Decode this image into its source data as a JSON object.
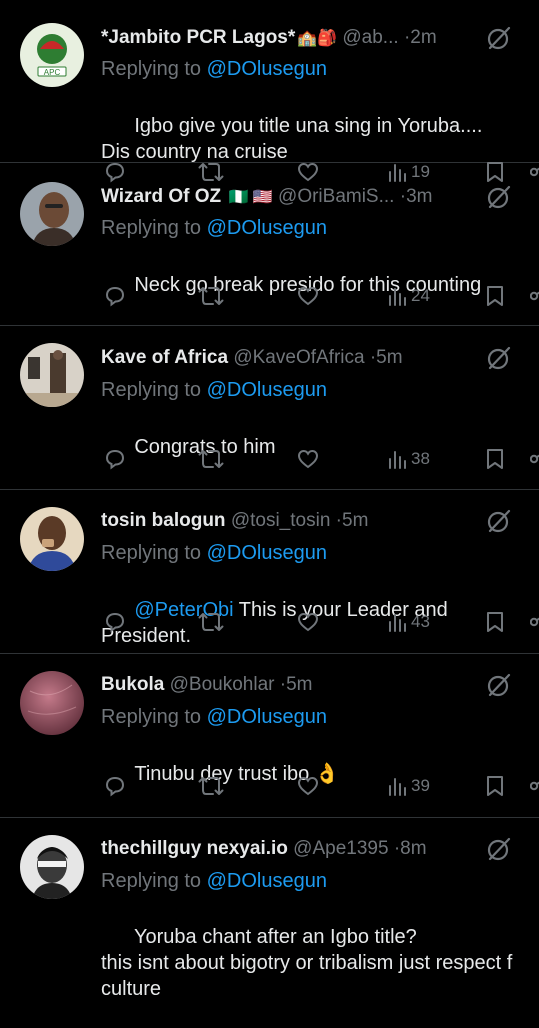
{
  "replying_label": "Replying to",
  "tweets": [
    {
      "name": "*Jambito PCR Lagos*",
      "flags": "🏫🎒",
      "handle": "@ab...",
      "dot": "·",
      "time": "2m",
      "replying_to": "@DOlusegun",
      "mention_prefix": "",
      "text": "Igbo give you title una sing in Yoruba.... Dis country na cruise",
      "views": "19",
      "avatar_label": "APC",
      "avatar_color": "#e8f0e0"
    },
    {
      "name": "Wizard Of OZ",
      "flags": "🇳🇬 🇺🇸",
      "handle": "@OriBamiS...",
      "dot": "·",
      "time": "3m",
      "replying_to": "@DOlusegun",
      "mention_prefix": "",
      "text": "Neck go break presido for this counting",
      "views": "24",
      "avatar_color": "#7a5a45"
    },
    {
      "name": "Kave of Africa",
      "flags": "",
      "handle": "@KaveOfAfrica",
      "dot": "·",
      "time": "5m",
      "replying_to": "@DOlusegun",
      "mention_prefix": "",
      "text": "Congrats to him",
      "views": "38",
      "avatar_color": "#d8d2c8"
    },
    {
      "name": "tosin balogun",
      "flags": "",
      "handle": "@tosi_tosin",
      "dot": "·",
      "time": "5m",
      "replying_to": "@DOlusegun",
      "mention_prefix": "@PeterObi",
      "text": " This is your Leader and President.",
      "views": "43",
      "avatar_color": "#c9a27a"
    },
    {
      "name": "Bukola",
      "flags": "",
      "handle": "@Boukohlar",
      "dot": "·",
      "time": "5m",
      "replying_to": "@DOlusegun",
      "mention_prefix": "",
      "text": "Tinubu dey trust ibo 👌",
      "views": "39",
      "avatar_color": "#8a4a5a"
    },
    {
      "name": "thechillguy nexyai.io",
      "flags": "",
      "handle": "@Ape1395",
      "dot": "·",
      "time": "8m",
      "replying_to": "@DOlusegun",
      "mention_prefix": "",
      "text": "Yoruba chant after an Igbo title?\nthis isnt about bigotry or tribalism just respect f\nculture",
      "views": "",
      "avatar_color": "#e0e0e0"
    }
  ],
  "colors": {
    "background": "#000000",
    "text": "#e7e9ea",
    "muted": "#71767b",
    "link": "#1d9bf0",
    "divider": "#2f3336"
  },
  "icons": {
    "more": "grok-icon",
    "reply": "reply-icon",
    "retweet": "retweet-icon",
    "like": "heart-icon",
    "views": "views-icon",
    "bookmark": "bookmark-icon",
    "share": "share-icon"
  }
}
